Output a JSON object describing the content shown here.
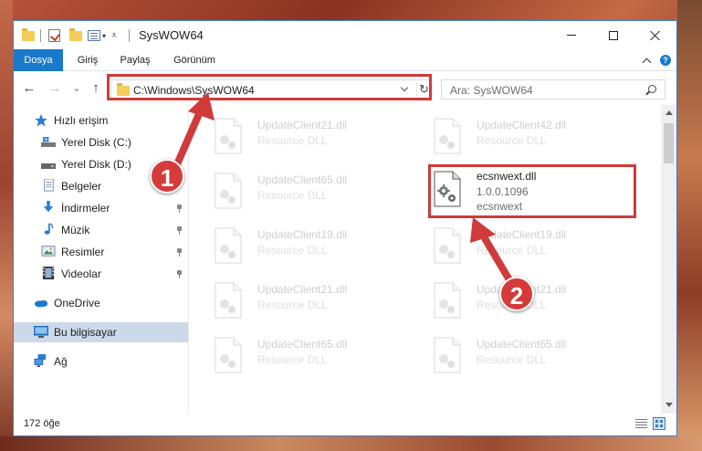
{
  "window": {
    "title": "SysWOW64"
  },
  "ribbon": {
    "tabs": [
      "Dosya",
      "Giriş",
      "Paylaş",
      "Görünüm"
    ],
    "help_label": "?"
  },
  "navigation": {
    "back_glyph": "←",
    "forward_glyph": "→",
    "recent_glyph": "⌄",
    "up_glyph": "↑",
    "address": "C:\\Windows\\SysWOW64",
    "refresh_glyph": "↻",
    "search_placeholder": "Ara: SysWOW64"
  },
  "sidebar": {
    "items": [
      {
        "label": "Hızlı erişim",
        "icon": "star-icon"
      },
      {
        "label": "Yerel Disk (C:)",
        "icon": "windows-drive-icon"
      },
      {
        "label": "Yerel Disk (D:)",
        "icon": "drive-icon"
      },
      {
        "label": "Belgeler",
        "icon": "documents-icon"
      },
      {
        "label": "İndirmeler",
        "icon": "download-icon"
      },
      {
        "label": "Müzik",
        "icon": "music-icon"
      },
      {
        "label": "Resimler",
        "icon": "pictures-icon"
      },
      {
        "label": "Videolar",
        "icon": "video-icon"
      },
      {
        "label": "OneDrive",
        "icon": "cloud-icon"
      },
      {
        "label": "Bu bilgisayar",
        "icon": "computer-icon"
      },
      {
        "label": "Ağ",
        "icon": "network-icon"
      }
    ],
    "selected": "Bu bilgisayar"
  },
  "files": {
    "left": [
      {
        "name": "UpdateClient21.dll",
        "desc": "Resource DLL"
      },
      {
        "name": "UpdateClient65.dll",
        "desc": "Resource DLL"
      },
      {
        "name": "UpdateClient19.dll",
        "desc": "Resource DLL"
      },
      {
        "name": "UpdateClient21.dll",
        "desc": "Resource DLL"
      },
      {
        "name": "UpdateClient65.dll",
        "desc": "Resource DLL"
      }
    ],
    "right": [
      {
        "name": "UpdateClient42.dll",
        "desc": "Resource DLL"
      },
      {
        "name": "UpdateClient19.dll",
        "desc": "Resource DLL"
      },
      {
        "name": "UpdateClient21.dll",
        "desc": "Resource DLL"
      },
      {
        "name": "UpdateClient65.dll",
        "desc": "Resource DLL"
      }
    ],
    "highlighted": {
      "name": "ecsnwext.dll",
      "version": "1.0.0.1096",
      "desc": "ecsnwext"
    }
  },
  "status": {
    "item_count": "172 öğe"
  },
  "annotations": {
    "step1": "1",
    "step2": "2",
    "color": "#d03a3a"
  }
}
